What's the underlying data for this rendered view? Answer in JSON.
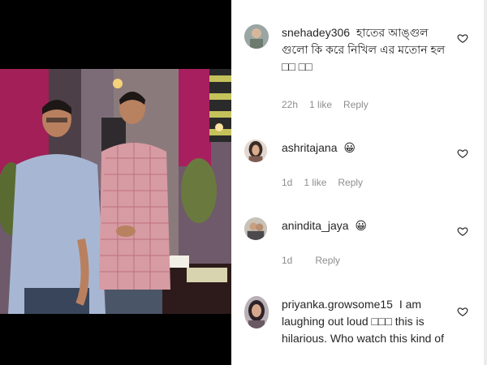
{
  "comments": [
    {
      "username": "snehadey306",
      "text": "হাতের আঙ্গুল গুলো কি করে নিখিল এর মতোন হল □□ □□",
      "time": "22h",
      "likes": "1 like",
      "reply": "Reply"
    },
    {
      "username": "ashritajana",
      "text": "😀",
      "time": "1d",
      "likes": "1 like",
      "reply": "Reply"
    },
    {
      "username": "anindita_jaya",
      "text": "😀",
      "time": "1d",
      "likes": "",
      "reply": "Reply"
    },
    {
      "username": "priyanka.growsome15",
      "text": "I am laughing out loud □□□ this is hilarious. Who watch this kind of",
      "time": "",
      "likes": "",
      "reply": ""
    }
  ],
  "icons": {
    "like": "heart-outline-icon"
  },
  "colors": {
    "text": "#262626",
    "meta": "#8e8e8e",
    "background": "#ffffff",
    "video_letterbox": "#000000"
  }
}
